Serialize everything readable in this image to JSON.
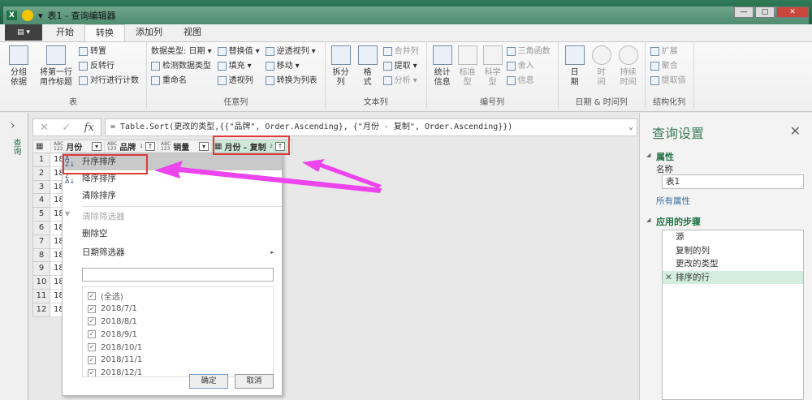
{
  "window": {
    "title": "表1 - 查询编辑器",
    "app_badge": "X",
    "buttons": [
      "—",
      "▢",
      "✕"
    ]
  },
  "tabs": [
    "开始",
    "转换",
    "添加列",
    "视图"
  ],
  "active_tab": "转换",
  "ribbon": {
    "table": {
      "label": "表",
      "group_by": "分组\n依据",
      "use_first_row": "将第一行\n用作标题",
      "transpose": "转置",
      "reverse_rows": "反转行",
      "count_rows": "对行进行计数"
    },
    "any_column": {
      "label": "任意列",
      "data_type": "数据类型: 日期",
      "detect_type": "检测数据类型",
      "rename": "重命名",
      "replace_values": "替换值",
      "fill": "填充",
      "pivot": "透视列",
      "unpivot": "逆透视列",
      "move": "移动",
      "to_list": "转换为列表"
    },
    "text_column": {
      "label": "文本列",
      "split": "拆分\n列",
      "format": "格\n式",
      "merge": "合并列",
      "extract": "提取",
      "parse": "分析"
    },
    "number_column": {
      "label": "编号列",
      "statistics": "统计\n信息",
      "standard": "标准\n型",
      "scientific": "科学\n型",
      "trig": "三角函数",
      "rounding": "舍入",
      "information": "信息"
    },
    "datetime_column": {
      "label": "日期 & 时间列",
      "date": "日\n期",
      "time": "时\n间",
      "duration": "持续\n时间"
    },
    "structured_column": {
      "label": "结构化列",
      "expand": "扩展",
      "aggregate": "聚合",
      "extract_values": "提取值"
    }
  },
  "left_nav": {
    "label": "查询"
  },
  "formula": {
    "text": "= Table.Sort(更改的类型,{{\"品牌\", Order.Ascending}, {\"月份 - 复制\", Order.Ascending}})"
  },
  "grid": {
    "columns": [
      {
        "name": "月份",
        "type": "ABC\n123"
      },
      {
        "name": "品牌",
        "type": "ABC\n123",
        "sort": "1"
      },
      {
        "name": "销量",
        "type": "ABC\n123"
      },
      {
        "name": "月份 - 复制",
        "type": "date",
        "sort": "2"
      }
    ],
    "rows": [
      "1",
      "2",
      "3",
      "4",
      "5",
      "6",
      "7",
      "8",
      "9",
      "10",
      "11",
      "12"
    ],
    "cell_prefix": "18"
  },
  "menu": {
    "items": [
      "升序排序",
      "降序排序",
      "清除排序",
      "清除筛选器",
      "删除空",
      "日期筛选器"
    ],
    "search_value": "",
    "checklist": [
      "(全选)",
      "2018/7/1",
      "2018/8/1",
      "2018/9/1",
      "2018/10/1",
      "2018/11/1",
      "2018/12/1"
    ],
    "ok": "确定",
    "cancel": "取消"
  },
  "panel": {
    "title": "查询设置",
    "properties": "属性",
    "name_label": "名称",
    "name_value": "表1",
    "all_properties": "所有属性",
    "applied_steps": "应用的步骤",
    "steps": [
      "源",
      "复制的列",
      "更改的类型",
      "排序的行"
    ]
  },
  "colors": {
    "accent": "#217346",
    "annotation": "#e0393a",
    "arrow": "#ee44ee"
  }
}
